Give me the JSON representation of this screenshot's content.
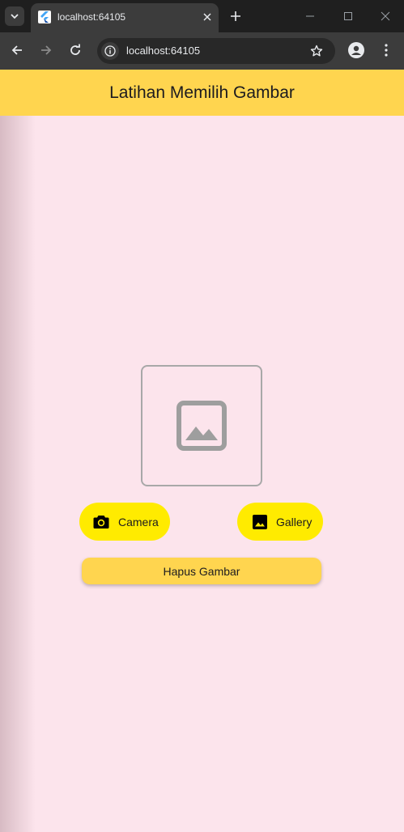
{
  "browser": {
    "tab_title": "localhost:64105",
    "url": "localhost:64105"
  },
  "app": {
    "title": "Latihan Memilih Gambar",
    "placeholder_icon": "image-icon",
    "buttons": {
      "camera": {
        "label": "Camera",
        "icon": "camera-icon"
      },
      "gallery": {
        "label": "Gallery",
        "icon": "image-icon"
      },
      "clear": {
        "label": "Hapus Gambar"
      }
    },
    "colors": {
      "appbar": "#ffd54f",
      "background": "#fce4ec",
      "pill_button": "#ffeb00"
    }
  }
}
